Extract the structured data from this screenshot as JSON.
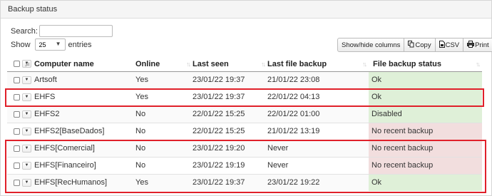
{
  "panel": {
    "title": "Backup status"
  },
  "search": {
    "label": "Search:",
    "value": ""
  },
  "length": {
    "show_label": "Show",
    "value": "25",
    "entries_label": "entries"
  },
  "toolbar": {
    "buttons": [
      {
        "label": "Show/hide columns",
        "icon": ""
      },
      {
        "label": "Copy",
        "icon": "copy-icon"
      },
      {
        "label": "CSV",
        "icon": "csv-icon"
      },
      {
        "label": "Print",
        "icon": "print-icon"
      }
    ]
  },
  "table": {
    "columns": [
      "Computer name",
      "Online",
      "Last seen",
      "Last file backup",
      "File backup status"
    ],
    "sort_glyph": "↑↓",
    "rows": [
      {
        "name": "Artsoft",
        "online": "Yes",
        "last_seen": "23/01/22 19:37",
        "last_backup": "21/01/22 23:08",
        "status": "Ok",
        "status_kind": "ok"
      },
      {
        "name": "EHFS",
        "online": "Yes",
        "last_seen": "23/01/22 19:37",
        "last_backup": "22/01/22 04:13",
        "status": "Ok",
        "status_kind": "ok"
      },
      {
        "name": "EHFS2",
        "online": "No",
        "last_seen": "22/01/22 15:25",
        "last_backup": "22/01/22 01:00",
        "status": "Disabled",
        "status_kind": "ok"
      },
      {
        "name": "EHFS2[BaseDados]",
        "online": "No",
        "last_seen": "22/01/22 15:25",
        "last_backup": "21/01/22 13:19",
        "status": "No recent backup",
        "status_kind": "bad"
      },
      {
        "name": "EHFS[Comercial]",
        "online": "No",
        "last_seen": "23/01/22 19:20",
        "last_backup": "Never",
        "status": "No recent backup",
        "status_kind": "bad"
      },
      {
        "name": "EHFS[Financeiro]",
        "online": "No",
        "last_seen": "23/01/22 19:19",
        "last_backup": "Never",
        "status": "No recent backup",
        "status_kind": "bad"
      },
      {
        "name": "EHFS[RecHumanos]",
        "online": "Yes",
        "last_seen": "23/01/22 19:37",
        "last_backup": "23/01/22 19:22",
        "status": "Ok",
        "status_kind": "ok"
      }
    ]
  },
  "colors": {
    "ok_bg": "#dff0d8",
    "bad_bg": "#f2dede",
    "highlight": "#e0202a"
  }
}
